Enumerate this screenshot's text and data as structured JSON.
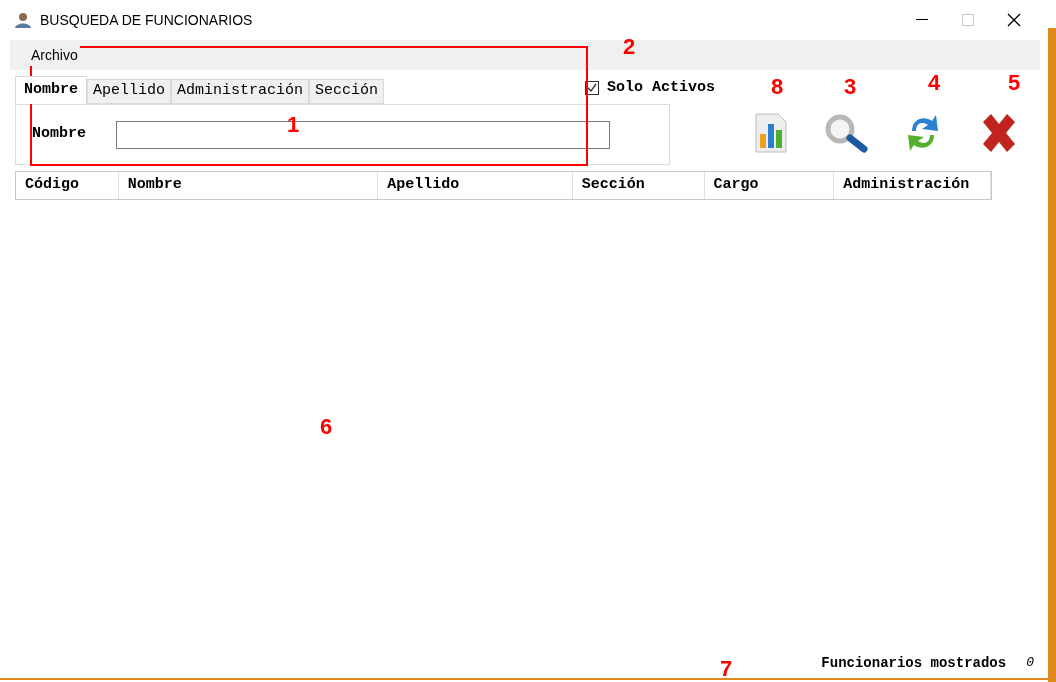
{
  "window": {
    "title": "BUSQUEDA DE FUNCIONARIOS"
  },
  "menu": [
    "Archivo"
  ],
  "tabs": [
    {
      "label": "Nombre",
      "selected": true
    },
    {
      "label": "Apellido",
      "selected": false
    },
    {
      "label": "Administración",
      "selected": false
    },
    {
      "label": "Sección",
      "selected": false
    }
  ],
  "search": {
    "label": "Nombre"
  },
  "solo_activos": {
    "label": "Solo Activos",
    "checked": true
  },
  "toolbar": [
    {
      "kind": "report"
    },
    {
      "kind": "search"
    },
    {
      "kind": "refresh"
    },
    {
      "kind": "close"
    }
  ],
  "table": {
    "columns": [
      "Código",
      "Nombre",
      "Apellido",
      "Sección",
      "Cargo",
      "Administración"
    ]
  },
  "status_bar": {
    "label": "Funcionarios mostrados",
    "count": "0"
  },
  "annotations": [
    {
      "label": "1",
      "kind": "box"
    },
    {
      "label": "2"
    },
    {
      "label": "8"
    },
    {
      "label": "3"
    },
    {
      "label": "4"
    },
    {
      "label": "5"
    },
    {
      "label": "6"
    },
    {
      "label": "7"
    }
  ]
}
